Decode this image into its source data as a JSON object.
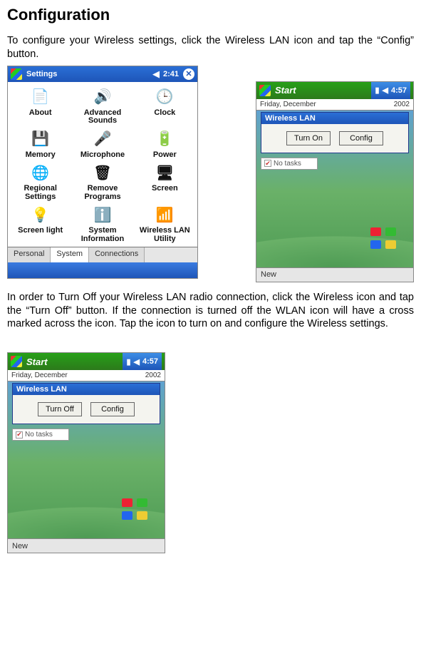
{
  "heading": "Configuration",
  "intro1": "To configure your Wireless settings, click the Wireless LAN icon and tap the “Config” button.",
  "intro2": "In order to Turn Off your Wireless LAN radio connection, click the Wireless icon and tap the “Turn Off” button. If the connection is turned off the WLAN icon will have a cross marked across the icon. Tap the icon to turn on and configure the Wireless settings.",
  "settings": {
    "title": "Settings",
    "clock": "2:41",
    "items": [
      {
        "label": "About",
        "icon": "📄"
      },
      {
        "label": "Advanced Sounds",
        "icon": "🔊"
      },
      {
        "label": "Clock",
        "icon": "🕒"
      },
      {
        "label": "Memory",
        "icon": "💾"
      },
      {
        "label": "Microphone",
        "icon": "🎤"
      },
      {
        "label": "Power",
        "icon": "🔋"
      },
      {
        "label": "Regional Settings",
        "icon": "🌐"
      },
      {
        "label": "Remove Programs",
        "icon": "🗑"
      },
      {
        "label": "Screen",
        "icon": "🖥"
      },
      {
        "label": "Screen light",
        "icon": "💡"
      },
      {
        "label": "System Information",
        "icon": "ℹ️"
      },
      {
        "label": "Wireless LAN Utility",
        "icon": "📶"
      }
    ],
    "tabs": [
      "Personal",
      "System",
      "Connections"
    ],
    "active_tab": "System"
  },
  "popupA": {
    "start": "Start",
    "clock": "4:57",
    "date": "Friday, December",
    "year": "2002",
    "wlan_title": "Wireless LAN",
    "btn1": "Turn On",
    "btn2": "Config",
    "tasks": "No tasks",
    "new": "New"
  },
  "popupB": {
    "start": "Start",
    "clock": "4:57",
    "date": "Friday, December",
    "year": "2002",
    "wlan_title": "Wireless LAN",
    "btn1": "Turn Off",
    "btn2": "Config",
    "tasks": "No tasks",
    "new": "New"
  }
}
